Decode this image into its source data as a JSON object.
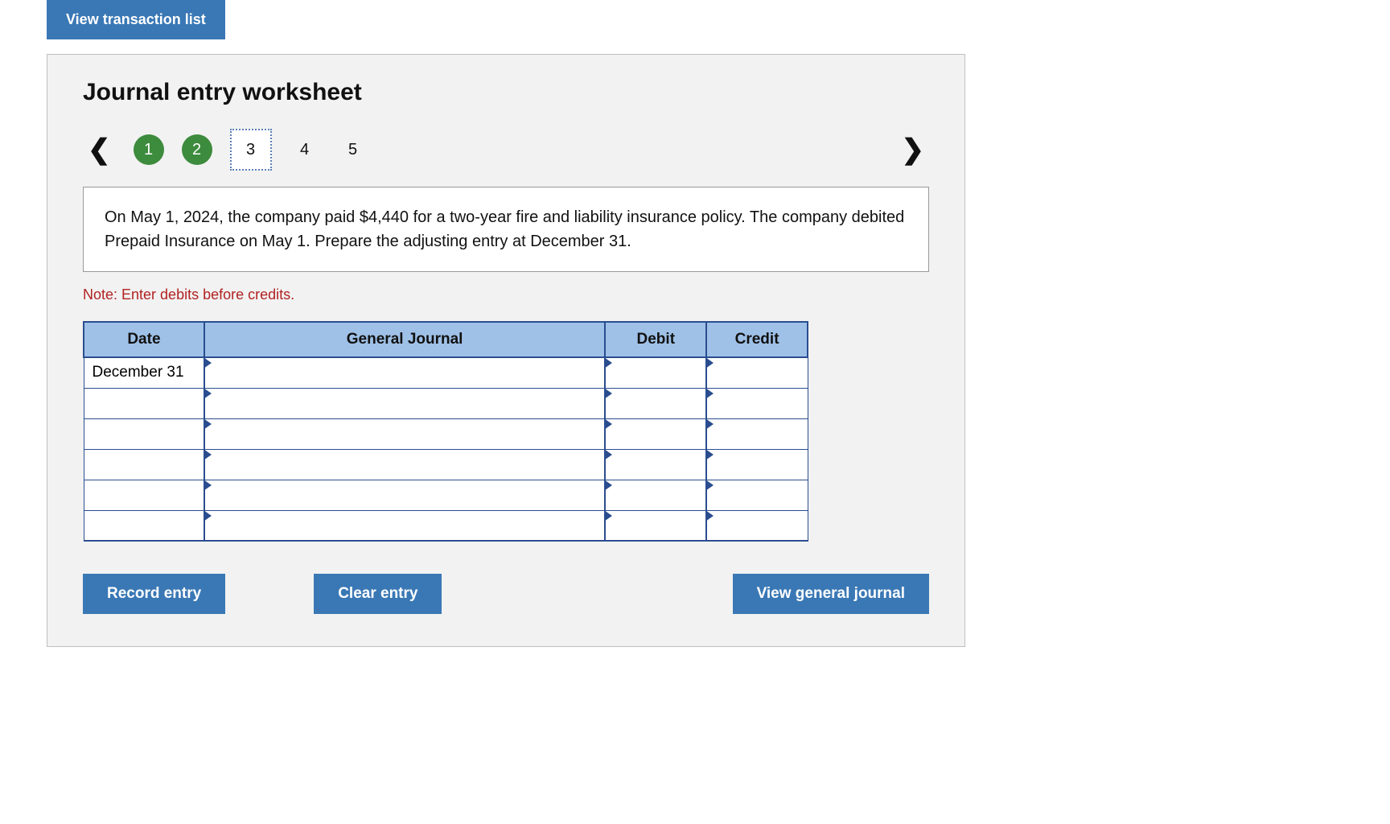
{
  "topButton": "View transaction list",
  "title": "Journal entry worksheet",
  "steps": [
    "1",
    "2",
    "3",
    "4",
    "5"
  ],
  "question": "On May 1, 2024, the company paid $4,440 for a two-year fire and liability insurance policy. The company debited Prepaid Insurance on May 1. Prepare the adjusting entry at December 31.",
  "note": "Note: Enter debits before credits.",
  "table": {
    "headers": {
      "date": "Date",
      "gj": "General Journal",
      "debit": "Debit",
      "credit": "Credit"
    },
    "rows": [
      {
        "date": "December 31",
        "gj": "",
        "debit": "",
        "credit": ""
      },
      {
        "date": "",
        "gj": "",
        "debit": "",
        "credit": ""
      },
      {
        "date": "",
        "gj": "",
        "debit": "",
        "credit": ""
      },
      {
        "date": "",
        "gj": "",
        "debit": "",
        "credit": ""
      },
      {
        "date": "",
        "gj": "",
        "debit": "",
        "credit": ""
      },
      {
        "date": "",
        "gj": "",
        "debit": "",
        "credit": ""
      }
    ]
  },
  "buttons": {
    "record": "Record entry",
    "clear": "Clear entry",
    "view": "View general journal"
  }
}
